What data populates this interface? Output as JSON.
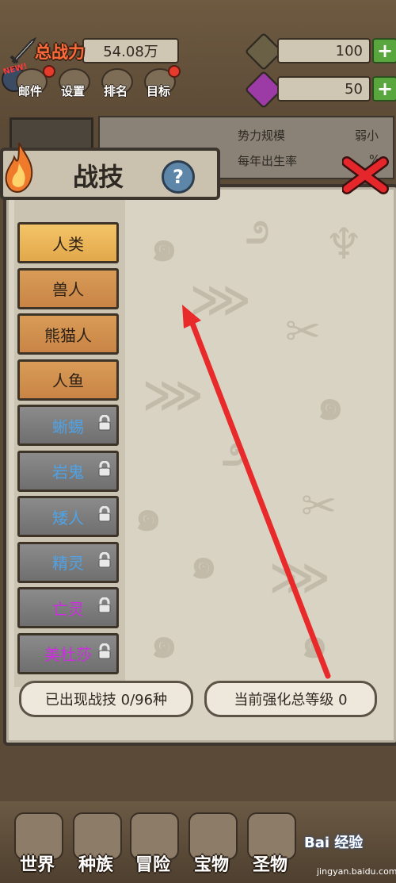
{
  "top_bar": {
    "power_label": "总战力",
    "power_value": "54.08万",
    "currency1_value": "100",
    "currency2_value": "50",
    "plus": "+"
  },
  "menu": {
    "new_badge": "NEW!",
    "items": [
      "邮件",
      "设置",
      "排名",
      "目标"
    ]
  },
  "info": {
    "rows": [
      {
        "key": "势力规模",
        "value": "弱小"
      },
      {
        "key": "每年出生率",
        "value": "%"
      }
    ]
  },
  "panel": {
    "title": "战技",
    "help": "?",
    "races": [
      {
        "label": "人类",
        "state": "selected",
        "color": "#2e2217"
      },
      {
        "label": "兽人",
        "state": "normal",
        "color": "#2e2217"
      },
      {
        "label": "熊猫人",
        "state": "normal",
        "color": "#2e2217"
      },
      {
        "label": "人鱼",
        "state": "normal",
        "color": "#2e2217"
      },
      {
        "label": "蜥蜴",
        "state": "locked",
        "color": "#4ea3e8"
      },
      {
        "label": "岩鬼",
        "state": "locked",
        "color": "#4ea3e8"
      },
      {
        "label": "矮人",
        "state": "locked",
        "color": "#4ea3e8"
      },
      {
        "label": "精灵",
        "state": "locked",
        "color": "#4ea3e8"
      },
      {
        "label": "亡灵",
        "state": "locked",
        "color": "#cc2de0"
      },
      {
        "label": "美杜莎",
        "state": "locked",
        "color": "#cc2de0"
      }
    ],
    "skills_appeared": "已出现战技 0/96种",
    "enhance_level": "当前强化总等级 0"
  },
  "nav": {
    "items": [
      "世界",
      "种族",
      "冒险",
      "宝物",
      "圣物"
    ]
  },
  "watermark": {
    "text": "Bai 经验",
    "sub": "jingyan.baidu.com"
  },
  "colors": {
    "accent_red": "#e5262a",
    "wood": "#d99c57",
    "locked": "#7c7c7d"
  }
}
